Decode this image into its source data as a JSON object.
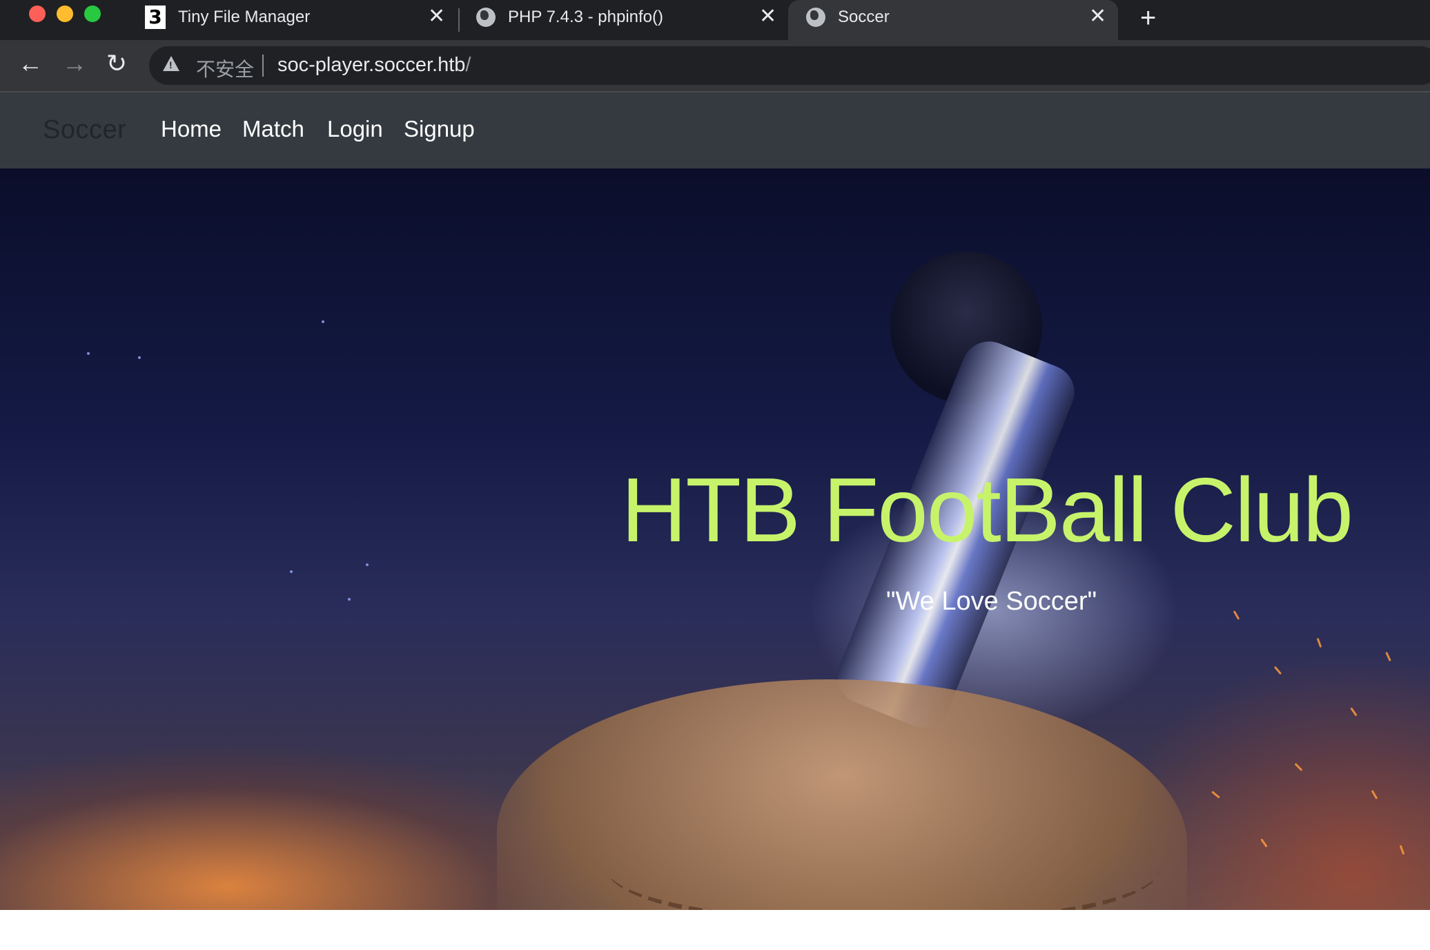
{
  "browser": {
    "tabs": [
      {
        "title": "Tiny File Manager",
        "favicon": "tinyfilemanager-logo",
        "active": false
      },
      {
        "title": "PHP 7.4.3 - phpinfo()",
        "favicon": "globe-icon",
        "active": false
      },
      {
        "title": "Soccer",
        "favicon": "globe-icon",
        "active": true
      }
    ],
    "tiny_file_manager_logo_text": "3",
    "security_label": "不安全",
    "url_host": "soc-player.soccer.htb",
    "url_path": "/"
  },
  "site": {
    "brand": "Soccer",
    "nav": {
      "home": "Home",
      "match": "Match",
      "login": "Login",
      "signup": "Signup"
    },
    "hero": {
      "title": "HTB FootBall Club",
      "subtitle": "\"We Love Soccer\"",
      "title_color": "#c7f36b"
    }
  }
}
